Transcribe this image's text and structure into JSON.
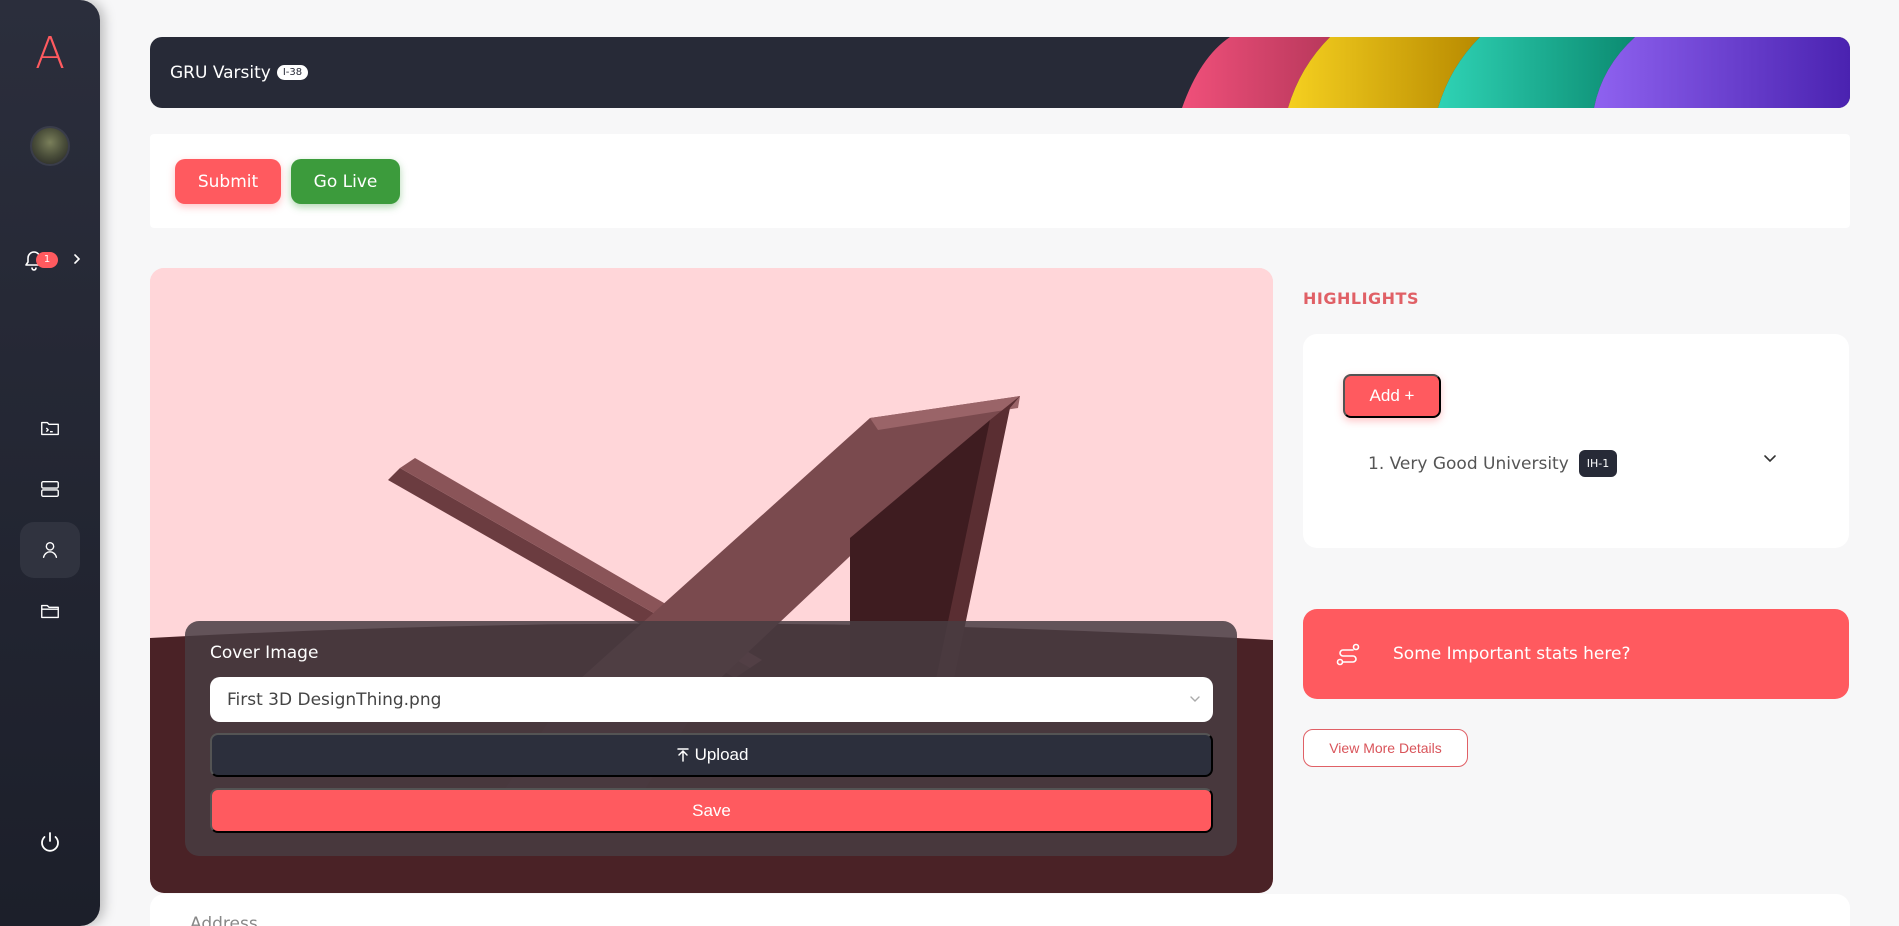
{
  "sidebar": {
    "logo": "A",
    "notification_count": "1"
  },
  "header": {
    "title": "GRU Varsity",
    "id_badge": "I-38"
  },
  "actions": {
    "submit_label": "Submit",
    "go_live_label": "Go Live"
  },
  "cover": {
    "label": "Cover Image",
    "selected_file": "First 3D DesignThing.png",
    "upload_label": "Upload",
    "save_label": "Save"
  },
  "highlights": {
    "title": "HIGHLIGHTS",
    "add_label": "Add +",
    "items": [
      {
        "label": "1. Very Good University",
        "badge": "IH-1"
      }
    ]
  },
  "stats": {
    "text": "Some Important stats here?"
  },
  "view_more_label": "View More Details",
  "address": {
    "label": "Address"
  },
  "colors": {
    "accent": "#ff5a5f",
    "success": "#3c9b3c",
    "dark": "#272a37"
  }
}
